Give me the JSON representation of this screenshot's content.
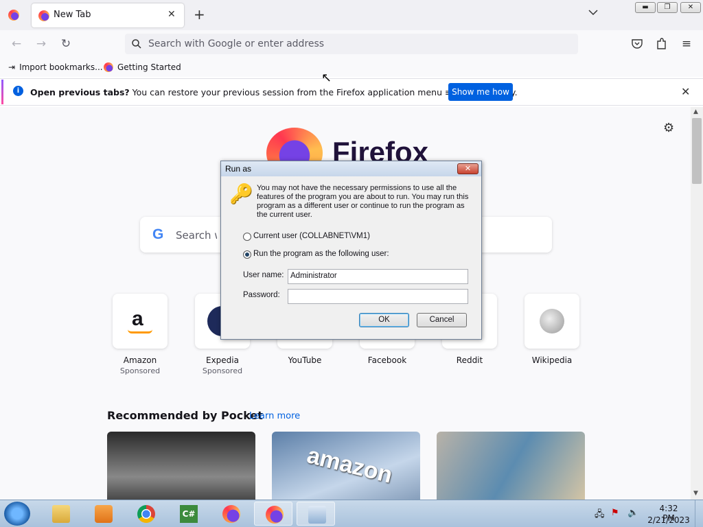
{
  "browser": {
    "tab_title": "New Tab",
    "url_placeholder": "Search with Google or enter address",
    "bookmarks": [
      "Import bookmarks...",
      "Getting Started"
    ]
  },
  "notification": {
    "bold": "Open previous tabs?",
    "text": " You can restore your previous session from the Firefox application menu ≡, under History.",
    "button": "Show me how"
  },
  "newtab": {
    "brand": "Firefox",
    "search_placeholder": "Search with Google or enter address",
    "tiles": [
      {
        "label": "Amazon",
        "sponsored": "Sponsored"
      },
      {
        "label": "Expedia",
        "sponsored": "Sponsored"
      },
      {
        "label": "YouTube",
        "sponsored": ""
      },
      {
        "label": "Facebook",
        "sponsored": ""
      },
      {
        "label": "Reddit",
        "sponsored": ""
      },
      {
        "label": "Wikipedia",
        "sponsored": ""
      }
    ],
    "pocket_title": "Recommended by Pocket",
    "pocket_learn": "Learn more",
    "card_text_amazon": "amazon"
  },
  "dialog": {
    "title": "Run as",
    "message": "You may not have the necessary permissions to use all the features of the program you are about to run. You may run this program as a different user or continue to run the program as the current user.",
    "option_current": "Current user (COLLABNET\\VM1)",
    "option_other": "Run the program as the following user:",
    "username_label": "User name:",
    "username_value": "Administrator",
    "password_label": "Password:",
    "password_value": "",
    "ok": "OK",
    "cancel": "Cancel"
  },
  "taskbar": {
    "time": "4:32 PM",
    "date": "2/21/2023",
    "csharp_label": "C#"
  },
  "colors": {
    "accent": "#0061e0",
    "dialog_title": "#c6d6ea"
  }
}
